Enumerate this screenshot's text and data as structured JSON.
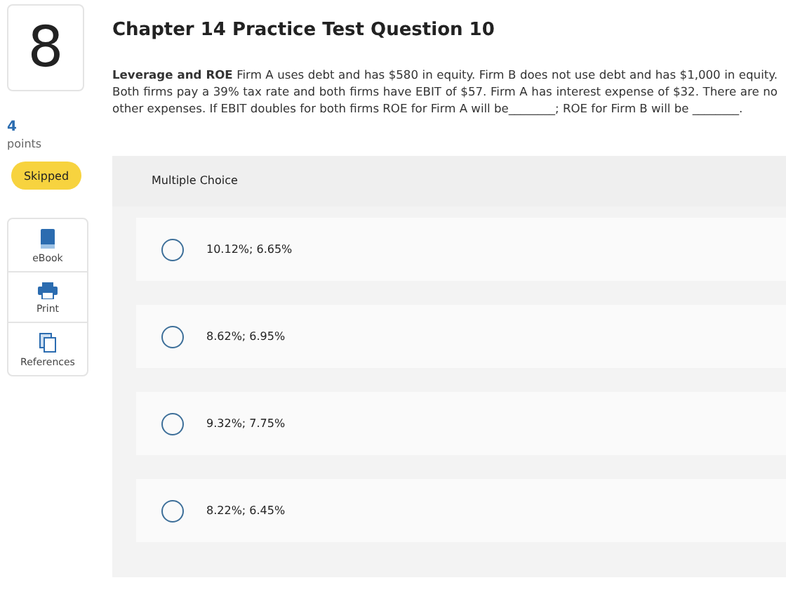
{
  "question": {
    "number": "8",
    "points": "4",
    "points_label": "points",
    "status": "Skipped",
    "title": "Chapter 14 Practice Test Question 10",
    "text": "**Leverage and ROE** Firm A uses debt and has $580 in equity. Firm B does not use debt and has $1,000 in equity. Both firms pay a 39% tax rate and both firms have EBIT of $57. Firm A has interest expense of $32. There are no other expenses. If EBIT doubles for both firms ROE for Firm A will be________; ROE for Firm B will be ________."
  },
  "tools": [
    {
      "kind": "book",
      "label": "eBook"
    },
    {
      "kind": "print",
      "label": "Print"
    },
    {
      "kind": "pages",
      "label": "References"
    }
  ],
  "answer": {
    "type": "Multiple Choice",
    "options": [
      {
        "label": "10.12%; 6.65%",
        "selected": false
      },
      {
        "label": "8.62%; 6.95%",
        "selected": false
      },
      {
        "label": "9.32%; 7.75%",
        "selected": false
      },
      {
        "label": "8.22%; 6.45%",
        "selected": false
      }
    ]
  }
}
